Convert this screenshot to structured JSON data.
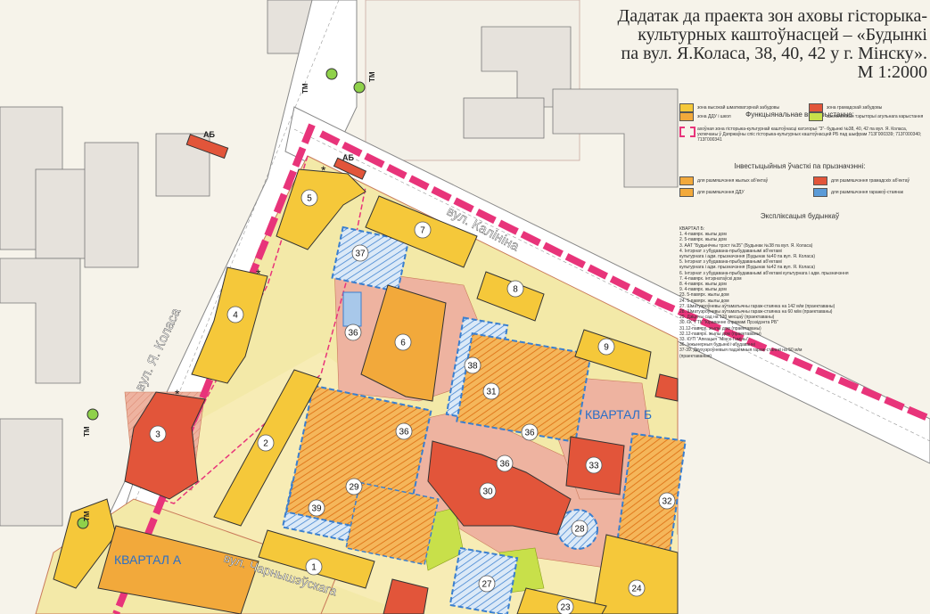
{
  "title": "Дадатак да праекта зон аховы гісторыка-\nкультурных каштоўнасцей – «Будынкі\nпа вул. Я.Коласа, 38, 40, 42 у г. Мінску».\nМ 1:2000",
  "legend": {
    "functional_heading": "Функцыянальнае выкарыстанне:",
    "functional_items": [
      {
        "label": "зона высокай шматкватэрнай забудовы",
        "color": "#f5c83a"
      },
      {
        "label": "зона грамадскай забудовы",
        "color": "#e2553a"
      },
      {
        "label": "зона ДДУ і школ",
        "color": "#f2a93b"
      },
      {
        "label": "азелененныя тэрыторыі агульнага карыстання",
        "color": "#c8e04a"
      }
    ],
    "protection_zone_text": "ахоўная зона гісторыка-культурнай каштоўнасці катэгорыі \"3\"- будынкі №38, 40, 42 па вул. Я. Коласа, уключаны ў Дзяржаўны спіс гісторыка-культурных каштоўнасцей РБ пад шыфрам 713Г000339; 713Г000340; 713Г000341",
    "investment_heading": "Інвестыцыйныя ўчасткі па прызначэнні:",
    "investment_items": [
      {
        "label": "для размяшчэння жылых аб'ектаў",
        "color": "#f2a93b"
      },
      {
        "label": "для размяшчэння грамадскіх аб'ектаў",
        "color": "#e2553a"
      },
      {
        "label": "для размяшчэння ДДУ",
        "color": "#f2a93b"
      },
      {
        "label": "для размяшчэння гаражоў-стаянак",
        "color": "#5b9bd8"
      }
    ],
    "explication_heading": "Экспліксацыя будынкаў",
    "explication_lines": [
      "КВАРТАЛ Б:",
      "1. 4-павярх. жылы дом",
      "2. 5-павярх. жылы дом",
      "3. ААТ \"Будынічны трэст №35\" (Будынак №38 па вул. Я. Коласа)",
      "4. Інтэрнат з убудавана-прыбудаванымі аб'ектамі",
      "   культурнага і адм. прызначэння (Будынак №40 па вул. Я. Коласа)",
      "5. Інтэрнат з убудавана-прыбудаванымі аб'ектамі",
      "   культурнага і адм. прызначэння (Будынак №42 па вул. Я. Коласа)",
      "6. Інтэрнат з убудавана-прыбудаванымі аб'ектамі культурнага і адм. прызначэння",
      "7. 4-павярх. інтэрнатаўскі дом",
      "8. 4-павярх. жылы дом",
      "9. 4-павярх. жылы дом",
      "23. 5-павярх. жылы дом",
      "24. 5-павярх. жылы дом",
      "27. Шматузроўневы аўтаматычны гараж-стаянка на 142 м/м (праектаваны)",
      "28. Шматузроўневы аўтаматычны гараж-стаянка на 60 м/м (праектаваны)",
      "29. Дзіцячы сад на 120 месцаў (праектаваны)",
      "30. ГК \"ГТК \"Кіраванне справамі Прэзідэнта РБ\"",
      "31.12-павярх. жылы дом (праектаваны)",
      "32.12-павярх. жылы дом (праектаваны)",
      "33. КУП \"Апеацыя \"Мінск-Гаміны\"",
      "36. Інжынерныя будынкі і збудаванні",
      "37-39. Двухузроўневыя падземныя гараж-стаянкі на 50 м/м",
      "   (праектаваныя)"
    ]
  },
  "map_labels": {
    "street_kolasa": "вул. Я. Коласа",
    "street_kalinina": "вул. Калініна",
    "street_charnyshevskaga": "вул. Чарнышэўскага",
    "quarter_a": "КВАРТАЛ А",
    "quarter_b": "КВАРТАЛ Б",
    "bus_stop": "АБ",
    "tram_stop": "ТМ",
    "star": "*"
  },
  "buildings": [
    "1",
    "2",
    "3",
    "4",
    "5",
    "6",
    "7",
    "8",
    "9",
    "23",
    "24",
    "27",
    "28",
    "29",
    "30",
    "31",
    "32",
    "33",
    "36",
    "37",
    "38",
    "39"
  ],
  "colors": {
    "residential": "#f5c83a",
    "public": "#e2553a",
    "school": "#f2a93b",
    "green": "#c8e04a",
    "block_bg": "#f3e9a8",
    "public_zone": "#eeb3a0",
    "protection_zone": "#e8347a",
    "garage": "#5b9bd8",
    "road": "#ffffff",
    "existing": "#e0e0e0"
  }
}
